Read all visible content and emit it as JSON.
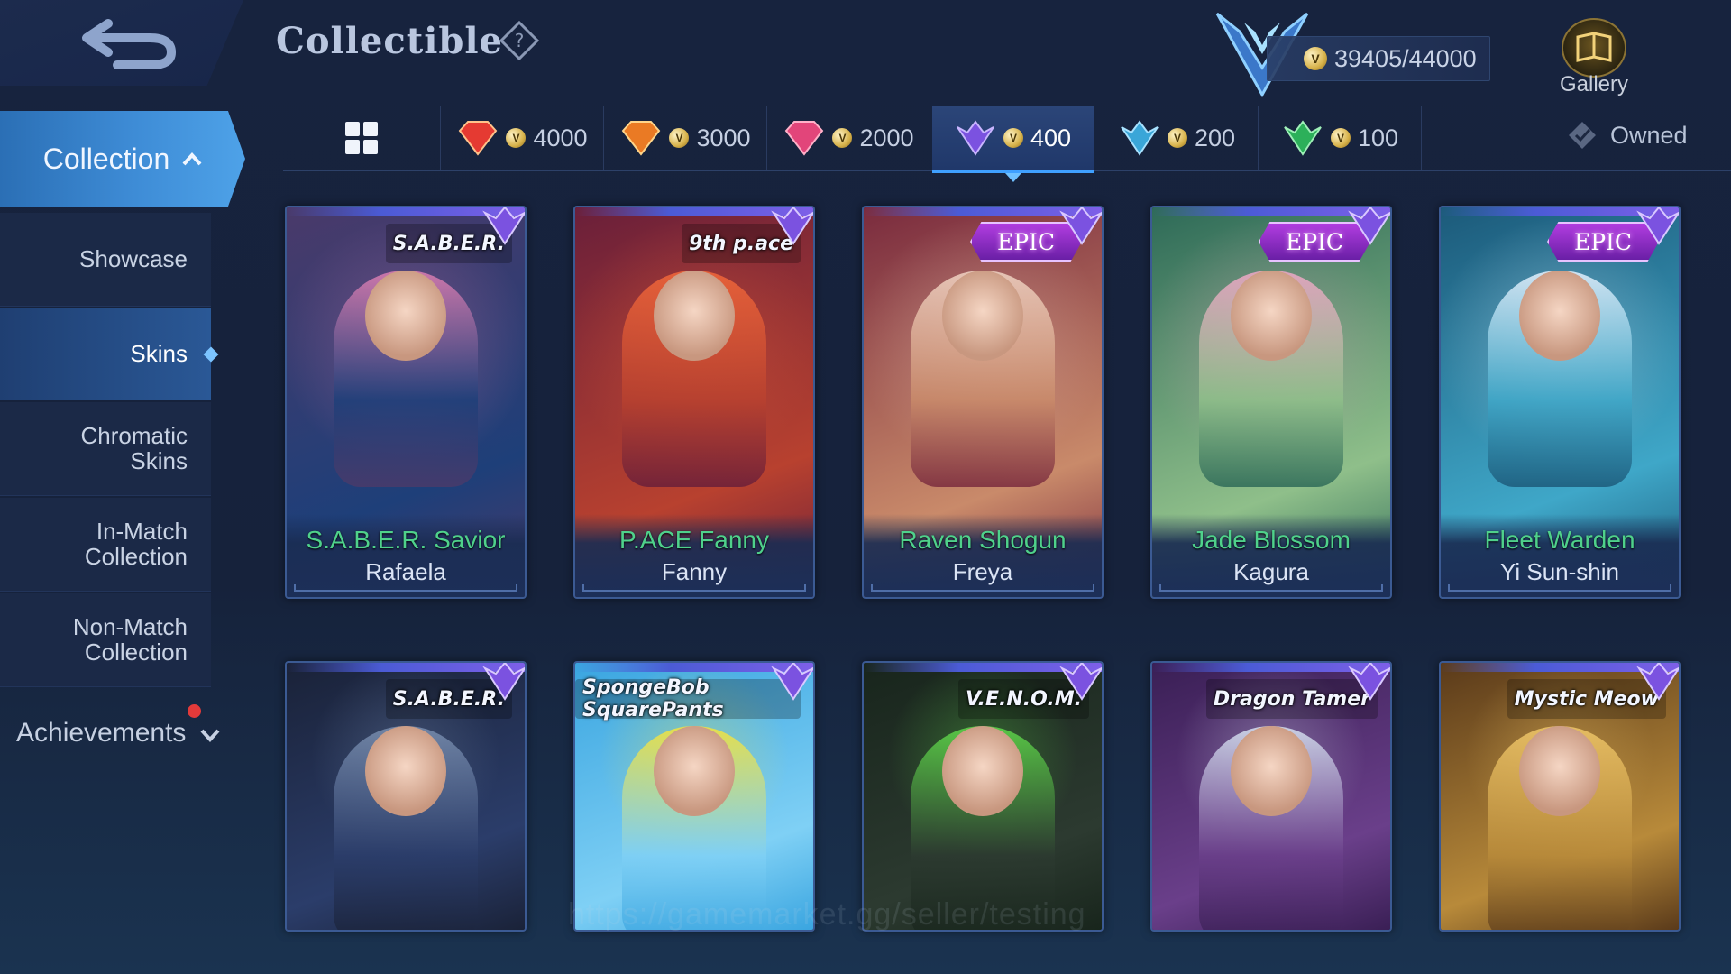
{
  "header": {
    "title": "Collectible",
    "currency": "39405/44000",
    "gallery_label": "Gallery"
  },
  "sidebar": {
    "collection_label": "Collection",
    "items": [
      {
        "label": "Showcase"
      },
      {
        "label": "Skins"
      },
      {
        "label": "Chromatic\nSkins"
      },
      {
        "label": "In-Match\nCollection"
      },
      {
        "label": "Non-Match\nCollection"
      }
    ],
    "achievements_label": "Achievements"
  },
  "filters": {
    "tabs": [
      {
        "value": "4000",
        "color": "#e53a32"
      },
      {
        "value": "3000",
        "color": "#ea7a24"
      },
      {
        "value": "2000",
        "color": "#e2457a"
      },
      {
        "value": "400",
        "color": "#7b52e0"
      },
      {
        "value": "200",
        "color": "#3aa6d8"
      },
      {
        "value": "100",
        "color": "#2cb05a"
      }
    ],
    "owned_label": "Owned"
  },
  "cards": [
    {
      "skin": "S.A.B.E.R. Savior",
      "hero": "Rafaela",
      "badge": "S.A.B.E.R.",
      "badge_type": "series",
      "colors": [
        "#4a3a6a",
        "#1e3f79",
        "#e07fb3"
      ]
    },
    {
      "skin": "P.ACE Fanny",
      "hero": "Fanny",
      "badge": "9th p.ace",
      "badge_type": "series",
      "colors": [
        "#6a1f3a",
        "#b8412f",
        "#f3683a"
      ]
    },
    {
      "skin": "Raven Shogun",
      "hero": "Freya",
      "badge": "EPIC",
      "badge_type": "epic",
      "colors": [
        "#7a2b3e",
        "#c98a6a",
        "#f1d5c5"
      ]
    },
    {
      "skin": "Jade Blossom",
      "hero": "Kagura",
      "badge": "EPIC",
      "badge_type": "epic",
      "colors": [
        "#2e6a58",
        "#8fbf8a",
        "#f1a8c8"
      ]
    },
    {
      "skin": "Fleet Warden",
      "hero": "Yi Sun-shin",
      "badge": "EPIC",
      "badge_type": "epic",
      "colors": [
        "#1c5a7a",
        "#3fa7c8",
        "#e8f3ff"
      ]
    },
    {
      "skin": "",
      "hero": "",
      "badge": "S.A.B.E.R.",
      "badge_type": "series",
      "colors": [
        "#1a2238",
        "#2b3d6a",
        "#7a8fb0"
      ]
    },
    {
      "skin": "",
      "hero": "",
      "badge": "SpongeBob SquarePants",
      "badge_type": "series",
      "colors": [
        "#3aa5e0",
        "#7fd0f5",
        "#f6e33a"
      ]
    },
    {
      "skin": "",
      "hero": "",
      "badge": "V.E.N.O.M.",
      "badge_type": "series",
      "colors": [
        "#18251c",
        "#2c3a30",
        "#5fd94a"
      ]
    },
    {
      "skin": "",
      "hero": "",
      "badge": "Dragon Tamer",
      "badge_type": "series",
      "colors": [
        "#3a1f55",
        "#6a3f8a",
        "#d8e4f3"
      ]
    },
    {
      "skin": "",
      "hero": "",
      "badge": "Mystic Meow",
      "badge_type": "series",
      "colors": [
        "#5a3a1a",
        "#b88a3a",
        "#f1c86a"
      ]
    }
  ],
  "watermark": "https://gamemarket.gg/seller/testing"
}
